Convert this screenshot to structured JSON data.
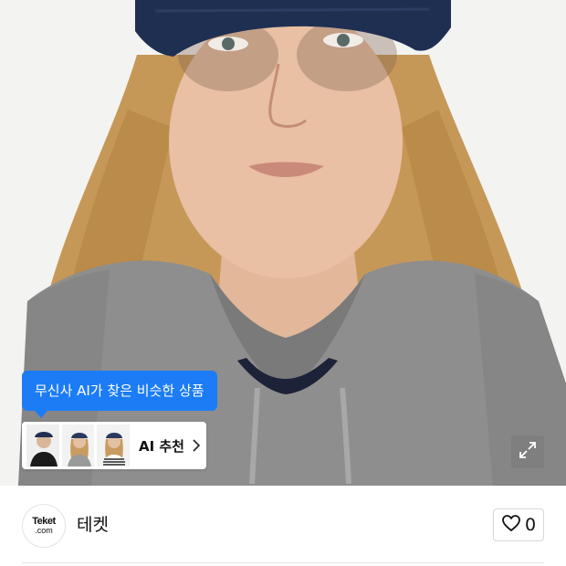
{
  "product_image": {
    "alt_icon": "product-photo",
    "ai_tooltip_text": "무신사 AI가 찾은 비슷한 상품",
    "ai_recommend_label": "AI 추천",
    "expand_icon": "expand-icon",
    "colors": {
      "tooltip": "#1c7cf5",
      "cap": "#1f2f52",
      "hoodie": "#8f8f8f",
      "hair": "#c79a5a"
    }
  },
  "brand": {
    "logo_text": "Teket",
    "logo_subtext": ".com",
    "name": "테켓",
    "like_count": "0",
    "like_icon": "heart-outline-icon"
  }
}
